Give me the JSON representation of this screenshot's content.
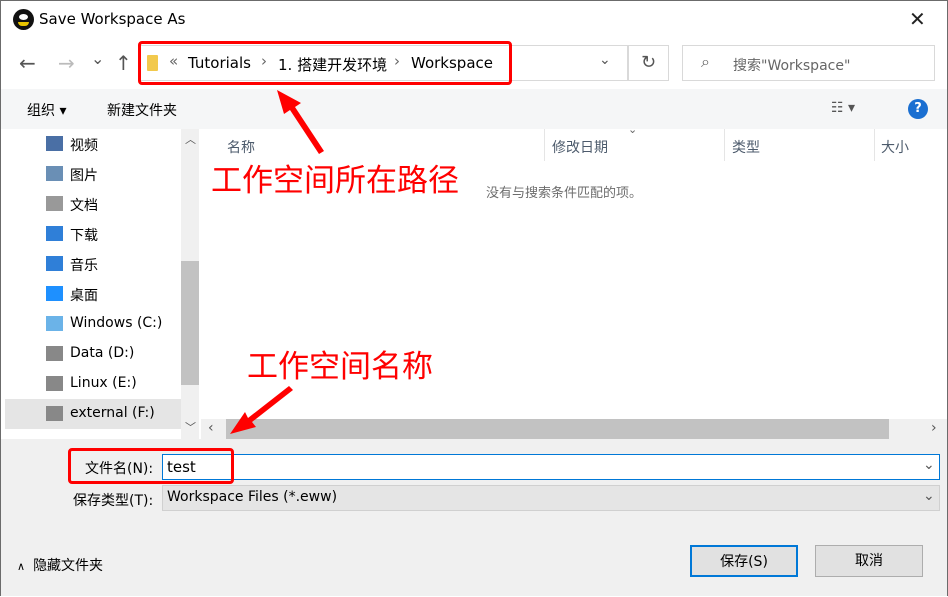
{
  "window": {
    "title": "Save Workspace As"
  },
  "nav": {
    "back": "←",
    "forward": "→",
    "recent": "⌄",
    "up": "↑"
  },
  "address": {
    "overflow": "«",
    "crumbs": [
      "Tutorials",
      "1. 搭建开发环境",
      "Workspace"
    ],
    "separator": "›",
    "dropdown": "⌄",
    "refresh": "↻"
  },
  "search": {
    "placeholder": "搜索\"Workspace\""
  },
  "toolbar": {
    "organize": "组织 ▾",
    "new_folder": "新建文件夹",
    "view": "☷ ▾",
    "help": "?"
  },
  "navpane": {
    "items": [
      {
        "label": "视频",
        "icon": "video-icon",
        "color": "#4a6fa5"
      },
      {
        "label": "图片",
        "icon": "pictures-icon",
        "color": "#6a8fb5"
      },
      {
        "label": "文档",
        "icon": "documents-icon",
        "color": "#999999"
      },
      {
        "label": "下载",
        "icon": "downloads-icon",
        "color": "#2f7fd8"
      },
      {
        "label": "音乐",
        "icon": "music-icon",
        "color": "#2f7fd8"
      },
      {
        "label": "桌面",
        "icon": "desktop-icon",
        "color": "#1e90ff"
      },
      {
        "label": "Windows (C:)",
        "icon": "drive-c-icon",
        "color": "#6bb3e8"
      },
      {
        "label": "Data (D:)",
        "icon": "drive-icon",
        "color": "#888888"
      },
      {
        "label": "Linux (E:)",
        "icon": "drive-icon",
        "color": "#888888"
      },
      {
        "label": "external (F:)",
        "icon": "drive-icon",
        "color": "#888888",
        "selected": true
      }
    ]
  },
  "columns": [
    "名称",
    "修改日期",
    "类型",
    "大小"
  ],
  "empty_message": "没有与搜索条件匹配的项。",
  "form": {
    "filename_label": "文件名(N):",
    "filename_value": "test",
    "filetype_label": "保存类型(T):",
    "filetype_value": "Workspace Files (*.eww)"
  },
  "footer": {
    "hide_folders": "隐藏文件夹",
    "save": "保存(S)",
    "cancel": "取消"
  },
  "annotations": {
    "path": "工作空间所在路径",
    "name": "工作空间名称",
    "color": "#ff0000"
  }
}
